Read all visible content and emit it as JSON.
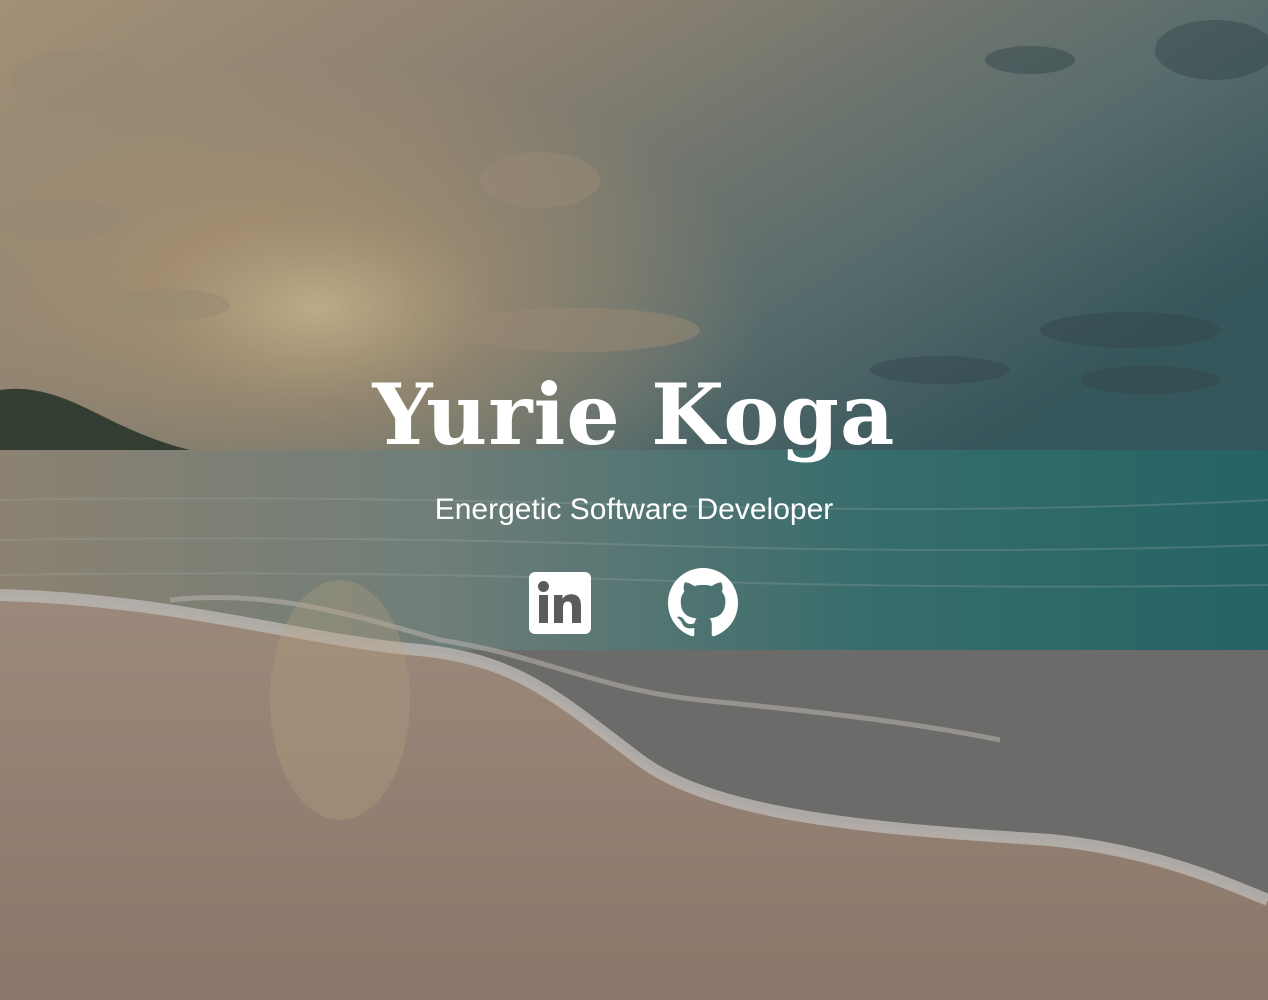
{
  "hero": {
    "name": "Yurie Koga",
    "tagline": "Energetic Software Developer"
  },
  "socials": [
    {
      "icon": "linkedin-icon",
      "label": "LinkedIn"
    },
    {
      "icon": "github-icon",
      "label": "GitHub"
    }
  ],
  "colors": {
    "text": "#ffffff",
    "sky_warm": "#f3c98f",
    "sea": "#2f8f8c",
    "sand": "#c9ad94"
  }
}
